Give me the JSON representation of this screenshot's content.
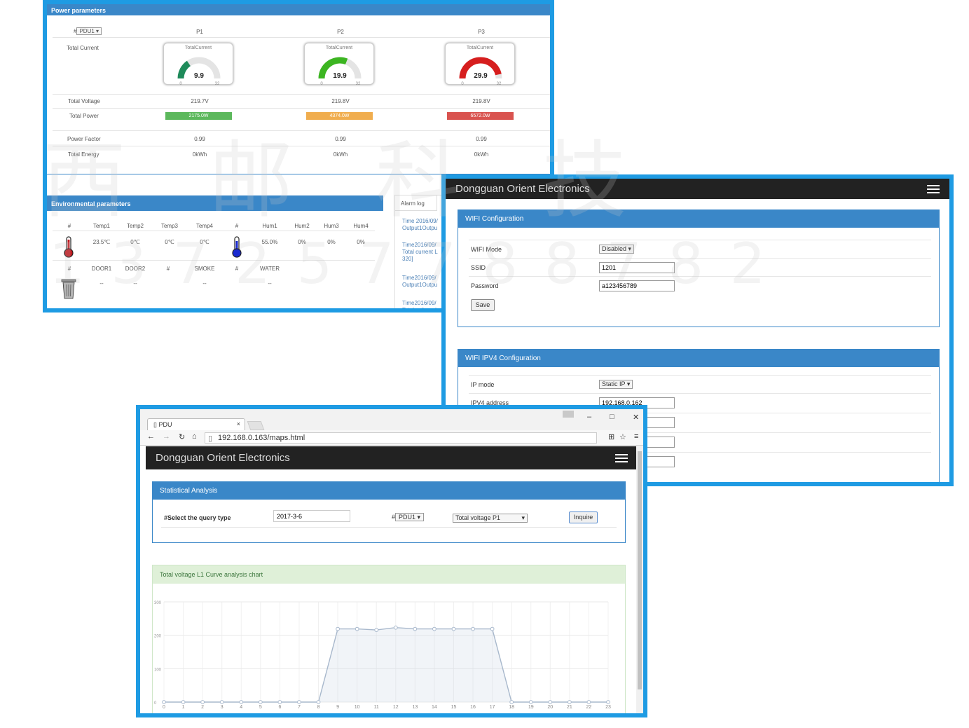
{
  "power_panel": {
    "title": "Power parameters",
    "selector": "PDU1",
    "selector_prefix": "#",
    "phases": [
      "P1",
      "P2",
      "P3"
    ],
    "rows": {
      "total_current": "Total Current",
      "total_voltage": "Total Voltage",
      "total_power": "Total Power",
      "power_factor": "Power Factor",
      "total_energy": "Total Energy"
    },
    "gauges": [
      {
        "label": "TotalCurrent",
        "value": "9.9",
        "level": 0.31,
        "color": "#1e8a5a",
        "min": "0",
        "max": "32"
      },
      {
        "label": "TotalCurrent",
        "value": "19.9",
        "level": 0.62,
        "color": "#3cb521",
        "min": "0",
        "max": "32"
      },
      {
        "label": "TotalCurrent",
        "value": "29.9",
        "level": 0.93,
        "color": "#d61e1e",
        "min": "0",
        "max": "32"
      }
    ],
    "voltages": [
      "219.7V",
      "219.8V",
      "219.8V"
    ],
    "powers": [
      {
        "text": "2175.0W",
        "color": "#5cb85c"
      },
      {
        "text": "4374.0W",
        "color": "#f0ad4e"
      },
      {
        "text": "6572.0W",
        "color": "#d9534f"
      }
    ],
    "power_factors": [
      "0.99",
      "0.99",
      "0.99"
    ],
    "energies": [
      "0kWh",
      "0kWh",
      "0kWh"
    ]
  },
  "env_panel": {
    "title": "Environmental parameters",
    "headers1": [
      "#",
      "Temp1",
      "Temp2",
      "Temp3",
      "Temp4",
      "#",
      "Hum1",
      "Hum2",
      "Hum3",
      "Hum4"
    ],
    "values1": [
      "23.5℃",
      "0℃",
      "0℃",
      "0℃",
      "55.0%",
      "0%",
      "0%",
      "0%"
    ],
    "headers2": [
      "#",
      "DOOR1",
      "DOOR2",
      "#",
      "SMOKE",
      "#",
      "WATER"
    ],
    "values2": [
      "--",
      "--",
      "--",
      "--"
    ],
    "icons": {
      "thermo_hot": "#c0171d",
      "thermo_cold": "#1a2ad0"
    }
  },
  "alarm_log": {
    "title": "Alarm log",
    "entries": [
      [
        "Time 2016/09/",
        "Output1Outpu"
      ],
      [
        "Time2016/09/",
        "Total current L",
        "320]"
      ],
      [
        "Time2016/09/",
        "Output1Outpu"
      ],
      [
        "Time2016/09/",
        "Total voltage l"
      ]
    ]
  },
  "wifi_app": {
    "brand": "Dongguan Orient Electronics",
    "wifi_config": {
      "title": "WIFI Configuration",
      "mode_label": "WIFI Mode",
      "mode_value": "Disabled",
      "ssid_label": "SSID",
      "ssid_value": "1201",
      "password_label": "Password",
      "password_value": "a123456789",
      "save_label": "Save"
    },
    "ipv4_config": {
      "title": "WIFI IPV4 Configuration",
      "ip_mode_label": "IP mode",
      "ip_mode_value": "Static IP",
      "ipv4_label": "IPV4 address",
      "ipv4_value": "192.168.0.162"
    }
  },
  "browser": {
    "tab_title": "PDU",
    "url": "192.168.0.163/maps.html",
    "brand": "Dongguan Orient Electronics",
    "stat_panel": {
      "title": "Statistical Analysis",
      "query_label": "#Select the query type",
      "date_value": "2017-3-6",
      "pdu_prefix": "#",
      "pdu_value": "PDU1",
      "type_value": "Total voltage P1",
      "inquire_label": "Inquire"
    },
    "chart_title": "Total voltage L1 Curve analysis chart"
  },
  "chart_data": {
    "type": "area",
    "title": "Total voltage L1 Curve analysis chart",
    "x": [
      0,
      1,
      2,
      3,
      4,
      5,
      6,
      7,
      8,
      9,
      10,
      11,
      12,
      13,
      14,
      15,
      16,
      17,
      18,
      19,
      20,
      21,
      22,
      23
    ],
    "tick_labels": [
      "0",
      "1",
      "2",
      "3",
      "4",
      "5",
      "6",
      "7",
      "8",
      "9",
      "10",
      "11",
      "12",
      "13",
      "14",
      "15",
      "16",
      "17",
      "18",
      "19",
      "20",
      "21",
      "22",
      "23"
    ],
    "y_ticks": [
      "0",
      "100",
      "200",
      "300"
    ],
    "series": [
      {
        "values": [
          0,
          0,
          0,
          0,
          0,
          0,
          0,
          0,
          0,
          219,
          219,
          216,
          223,
          219,
          219,
          219,
          219,
          219,
          0,
          0,
          0,
          0,
          0,
          0
        ]
      }
    ],
    "ylim": [
      0,
      300
    ],
    "color": "#a8b8cc",
    "grid": true
  },
  "watermark": {
    "line1": "西 邮 科 技",
    "line2": "1 3 7 2 5 7 7 8 8 7 8 2"
  }
}
